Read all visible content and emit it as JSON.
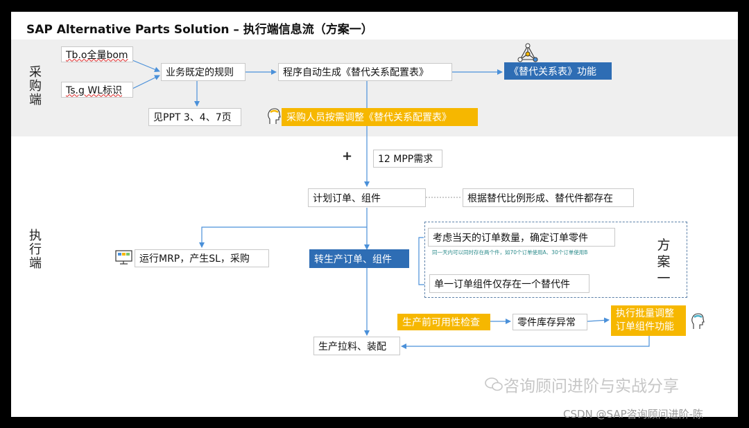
{
  "title": "SAP Alternative Parts Solution – 执行端信息流（方案一）",
  "sections": {
    "procurement": "采购端",
    "execution": "执行端"
  },
  "scheme_label": "方案一",
  "plus": "+",
  "boxes": {
    "tbo_bom": "Tb.o全量bom",
    "tsg_wl": "Ts.g WL标识",
    "business_rules": "业务既定的规则",
    "see_ppt": "见PPT 3、4、7页",
    "auto_generate": "程序自动生成《替代关系配置表》",
    "alt_relation_function": "《替代关系表》功能",
    "buyer_adjust": "采购人员按需调整《替代关系配置表》",
    "mpp_12": "12 MPP需求",
    "plan_order": "计划订单、组件",
    "ratio_form": "根据替代比例形成、替代件都存在",
    "run_mrp": "运行MRP，产生SL，采购",
    "convert_order": "转生产订单、组件",
    "consider_qty": "考虑当天的订单数量，确定订单零件",
    "single_component": "单一订单组件仅存在一个替代件",
    "pre_check": "生产前可用性检查",
    "inventory_exception": "零件库存异常",
    "batch_adjust": "执行批量调整订单组件功能",
    "production_pick": "生产拉料、装配"
  },
  "note": "同一天内可以同时存在两个件，如70个订单使用A、30个订单使用B",
  "watermarks": {
    "wechat": "咨询顾问进阶与实战分享",
    "csdn": "CSDN @SAP咨询顾问进阶-陈"
  },
  "colors": {
    "blue": "#2e6db4",
    "yellow": "#f6b700",
    "band": "#efefef",
    "arrow": "#4a90d9"
  }
}
